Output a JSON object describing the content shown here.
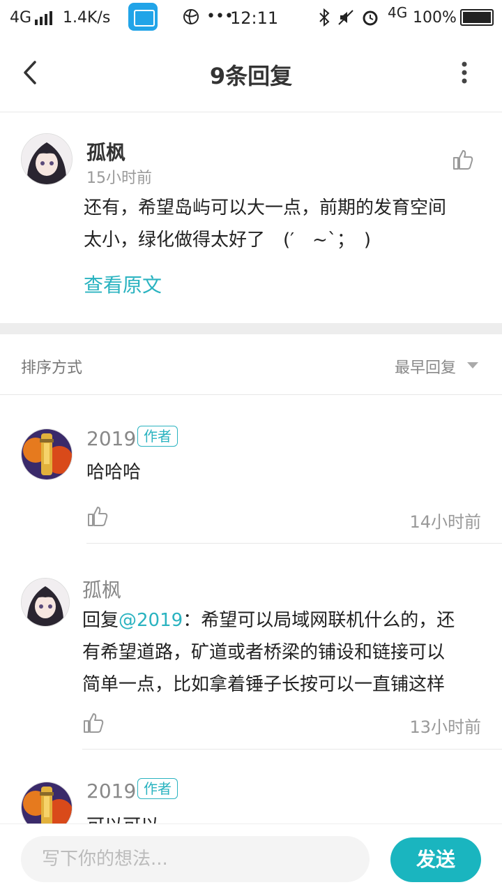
{
  "status_bar": {
    "network": "4G",
    "speed": "1.4K/s",
    "time": "12:11",
    "dots": "•••",
    "network_right": "4G",
    "battery": "100%"
  },
  "header": {
    "title": "9条回复",
    "back_icon": "chevron-left-icon",
    "more_icon": "more-vertical-icon"
  },
  "original_comment": {
    "author": "孤枫",
    "time": "15小时前",
    "text_line1": "还有，希望岛屿可以大一点，前期的发育空间",
    "text_line2": "太小，绿化做得太好了　(′　~`；　)",
    "view_original": "查看原文"
  },
  "sort": {
    "label": "排序方式",
    "value": "最早回复"
  },
  "replies": [
    {
      "name": "2019",
      "badge": "作者",
      "text": "哈哈哈",
      "time": "14小时前"
    },
    {
      "name": "孤枫",
      "reply_prefix": "回复",
      "mention": "@2019",
      "line1": "：希望可以局域网联机什么的，还",
      "line2": "有希望道路，矿道或者桥梁的铺设和链接可以",
      "line3": "简单一点，比如拿着锤子长按可以一直铺这样",
      "time": "13小时前"
    },
    {
      "name": "2019",
      "badge": "作者",
      "text": "可以可以"
    }
  ],
  "composer": {
    "placeholder": "写下你的想法...",
    "send": "发送"
  },
  "colors": {
    "accent": "#1ab5bf",
    "link": "#2ab3c0"
  }
}
